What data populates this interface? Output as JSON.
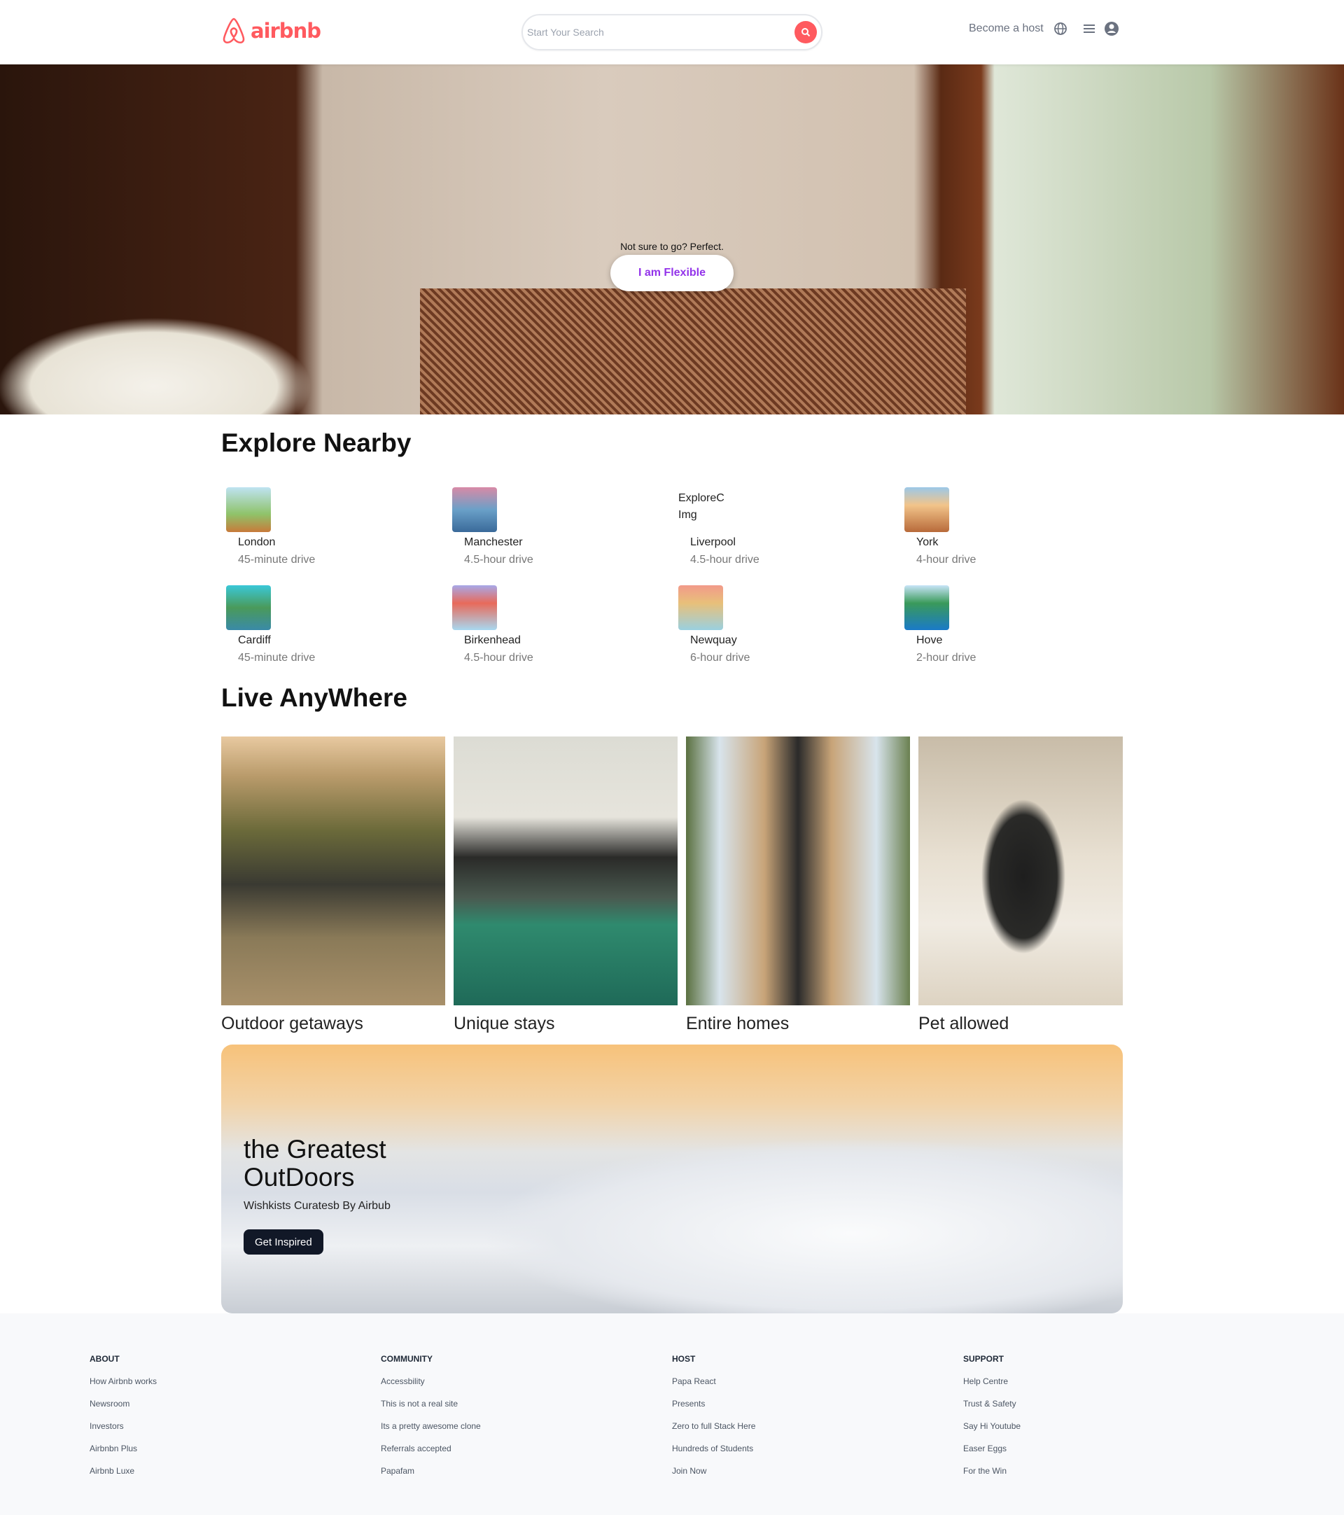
{
  "header": {
    "brand": "airbnb",
    "search_placeholder": "Start Your Search",
    "become_host": "Become a host",
    "brand_color": "#ff5a5f"
  },
  "hero": {
    "tagline": "Not sure to go? Perfect.",
    "button": "I am Flexible"
  },
  "explore": {
    "title": "Explore Nearby",
    "broken_img_alt": "ExploreC Img",
    "items": [
      {
        "name": "London",
        "distance": "45-minute drive"
      },
      {
        "name": "Manchester",
        "distance": "4.5-hour drive"
      },
      {
        "name": "Liverpool",
        "distance": "4.5-hour drive"
      },
      {
        "name": "York",
        "distance": "4-hour drive"
      },
      {
        "name": "Cardiff",
        "distance": "45-minute drive"
      },
      {
        "name": "Birkenhead",
        "distance": "4.5-hour drive"
      },
      {
        "name": "Newquay",
        "distance": "6-hour drive"
      },
      {
        "name": "Hove",
        "distance": "2-hour drive"
      }
    ]
  },
  "live": {
    "title": "Live AnyWhere",
    "cards": [
      {
        "title": "Outdoor getaways"
      },
      {
        "title": "Unique stays"
      },
      {
        "title": "Entire homes"
      },
      {
        "title": "Pet allowed"
      }
    ]
  },
  "banner": {
    "title": "the Greatest OutDoors",
    "subtitle": "Wishkists Curatesb By Airbub",
    "button": "Get Inspired"
  },
  "footer": {
    "columns": [
      {
        "heading": "ABOUT",
        "links": [
          "How Airbnb works",
          "Newsroom",
          "Investors",
          "Airbnbn Plus",
          "Airbnb Luxe"
        ]
      },
      {
        "heading": "COMMUNITY",
        "links": [
          "Accessbility",
          "This is not a real site",
          "Its a pretty awesome clone",
          "Referrals accepted",
          "Papafam"
        ]
      },
      {
        "heading": "HOST",
        "links": [
          "Papa React",
          "Presents",
          "Zero to full Stack Here",
          "Hundreds of Students",
          "Join Now"
        ]
      },
      {
        "heading": "SUPPORT",
        "links": [
          "Help Centre",
          "Trust & Safety",
          "Say Hi Youtube",
          "Easer Eggs",
          "For the Win"
        ]
      }
    ]
  }
}
